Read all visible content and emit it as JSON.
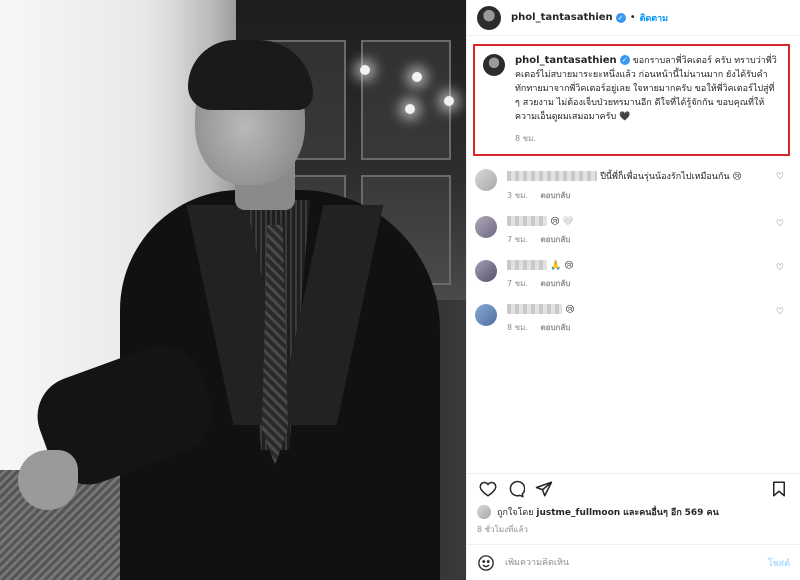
{
  "post": {
    "author": "phol_tantasathien",
    "follow_label": "ติดตาม",
    "dot": "•"
  },
  "caption": {
    "username": "phol_tantasathien",
    "text": "ขอกราบลาพี่วิคเตอร์ ครับ ทราบว่าพี่วิคเตอร์ไม่สบายมาระยะหนึ่งแล้ว ก่อนหน้านี้ไม่นานมาก ยังได้รับคำทักทายมาจากพี่วิคเตอร์อยู่เลย ใจหายมากครับ ขอให้พี่วิคเตอร์ไปสู่ที่ ๆ สวยงาม ไม่ต้องเจ็บป่วยทรมานอีก ดีใจที่ได้รู้จักกัน ขอบคุณที่ให้ความเอ็นดูผมเสมอมาครับ 🖤",
    "time": "8 ชม."
  },
  "comments": [
    {
      "text": "ปีนี้พี่ก็เพื่อนรุ่นน้องรักไปเหมือนกัน 😢",
      "time": "3 ชม.",
      "reply": "ตอบกลับ"
    },
    {
      "text": "😢 🤍",
      "time": "7 ชม.",
      "reply": "ตอบกลับ"
    },
    {
      "text": "🙏 😢",
      "time": "7 ชม.",
      "reply": "ตอบกลับ"
    },
    {
      "text": "😢",
      "time": "8 ชม.",
      "reply": "ตอบกลับ"
    }
  ],
  "likes": {
    "prefix": "ถูกใจโดย",
    "user": "justme_fullmoon",
    "middle": "และคนอื่นๆ อีก",
    "count": "569 คน"
  },
  "posted_ago": "8 ชั่วโมงที่แล้ว",
  "add_comment": {
    "placeholder": "เพิ่มความคิดเห็น",
    "post_label": "โพสต์"
  },
  "icons": {
    "heart": "heart-icon",
    "comment": "comment-icon",
    "share": "share-icon",
    "save": "bookmark-icon",
    "emoji": "smile-icon"
  },
  "colors": {
    "accent_blue": "#0095f6",
    "highlight_border": "#d42a2a"
  }
}
